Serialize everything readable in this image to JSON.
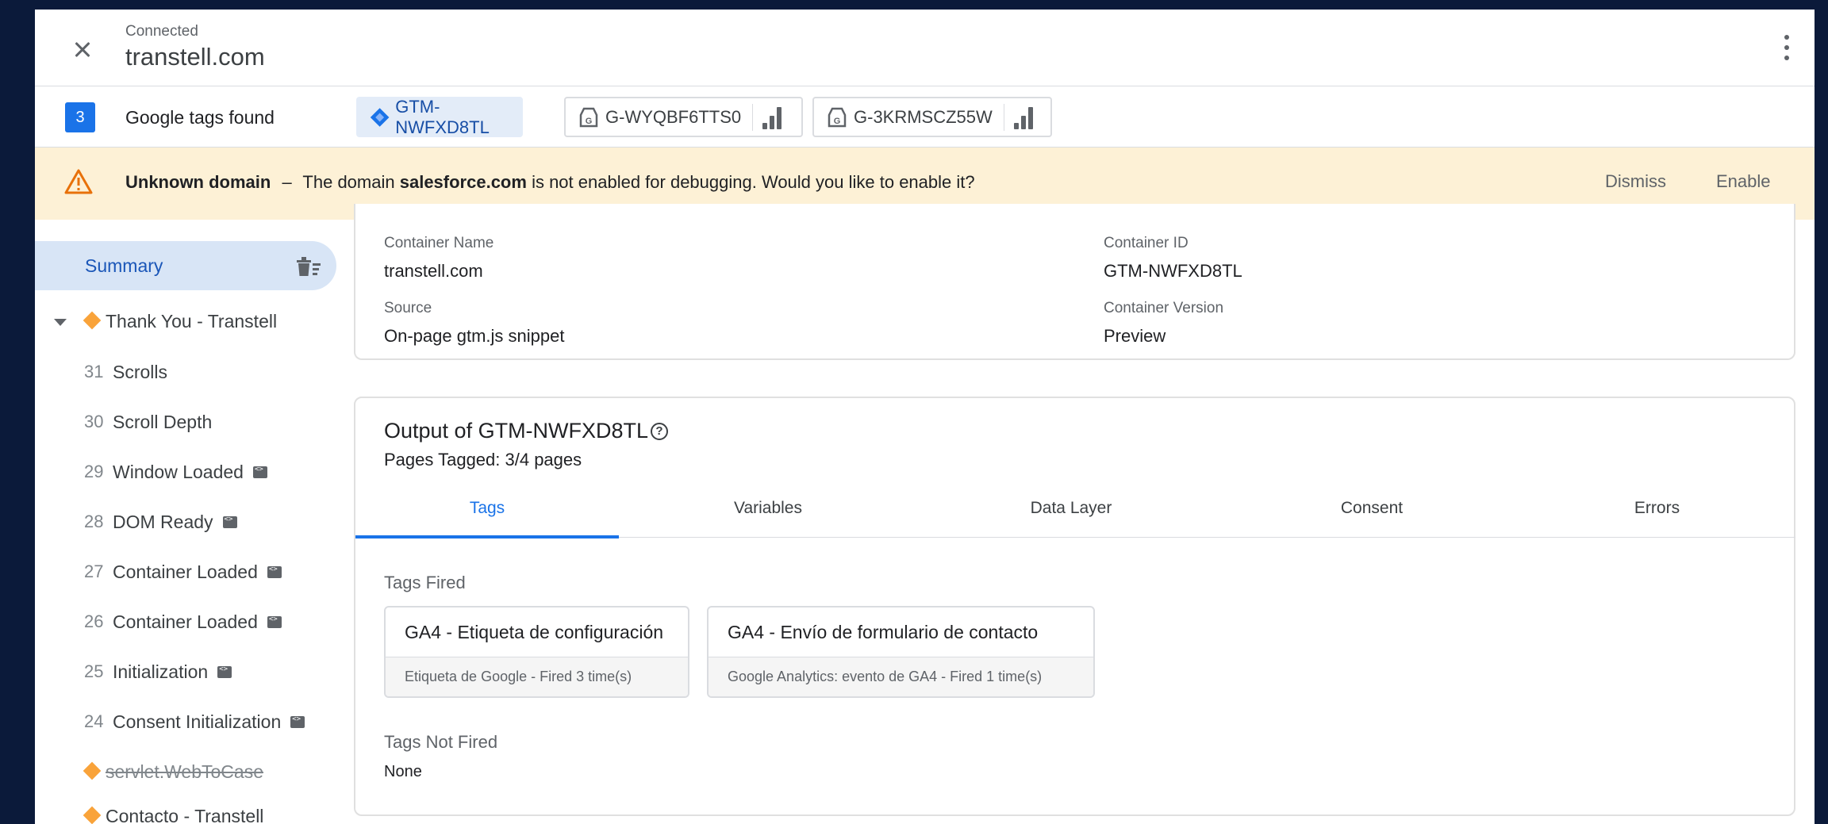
{
  "header": {
    "status": "Connected",
    "domain": "transtell.com",
    "close_icon": "close-icon",
    "more_icon": "more-vert-icon"
  },
  "tags_bar": {
    "count": "3",
    "label": "Google tags found",
    "chips": [
      {
        "id": "GTM-NWFXD8TL",
        "icon": "gtm-diamond-icon",
        "active": true
      },
      {
        "id": "G-WYQBF6TTS0",
        "icon": "google-tag-icon",
        "active": false
      },
      {
        "id": "G-3KRMSCZ55W",
        "icon": "google-tag-icon",
        "active": false
      }
    ]
  },
  "banner": {
    "title": "Unknown domain",
    "dash": "–",
    "pre": "The domain",
    "domain": "salesforce.com",
    "post": "is not enabled for debugging. Would you like to enable it?",
    "dismiss": "Dismiss",
    "enable": "Enable"
  },
  "sidebar": {
    "summary": "Summary",
    "page_group": "Thank You - Transtell",
    "events": [
      {
        "num": "31",
        "label": "Scrolls",
        "code": false
      },
      {
        "num": "30",
        "label": "Scroll Depth",
        "code": false
      },
      {
        "num": "29",
        "label": "Window Loaded",
        "code": true
      },
      {
        "num": "28",
        "label": "DOM Ready",
        "code": true
      },
      {
        "num": "27",
        "label": "Container Loaded",
        "code": true
      },
      {
        "num": "26",
        "label": "Container Loaded",
        "code": true
      },
      {
        "num": "25",
        "label": "Initialization",
        "code": true
      },
      {
        "num": "24",
        "label": "Consent Initialization",
        "code": true
      }
    ],
    "page_struck": "servlet.WebToCase",
    "page_next": "Contacto - Transtell"
  },
  "container_info": {
    "name_label": "Container Name",
    "name_value": "transtell.com",
    "id_label": "Container ID",
    "id_value": "GTM-NWFXD8TL",
    "source_label": "Source",
    "source_value": "On-page gtm.js snippet",
    "version_label": "Container Version",
    "version_value": "Preview"
  },
  "output": {
    "title": "Output of GTM-NWFXD8TL",
    "help": "?",
    "pages_tagged": "Pages Tagged: 3/4 pages",
    "tabs": [
      "Tags",
      "Variables",
      "Data Layer",
      "Consent",
      "Errors"
    ],
    "active_tab": "Tags",
    "fired_title": "Tags Fired",
    "fired": [
      {
        "name": "GA4 - Etiqueta de configuración",
        "sub": "Etiqueta de Google - Fired 3 time(s)"
      },
      {
        "name": "GA4 - Envío de formulario de contacto",
        "sub": "Google Analytics: evento de GA4 - Fired 1 time(s)"
      }
    ],
    "not_fired_title": "Tags Not Fired",
    "not_fired_value": "None"
  },
  "colors": {
    "accent": "#1a73e8",
    "banner_bg": "#fdf1d6",
    "warning": "#e8710a",
    "page_diamond": "#f9a33a"
  }
}
